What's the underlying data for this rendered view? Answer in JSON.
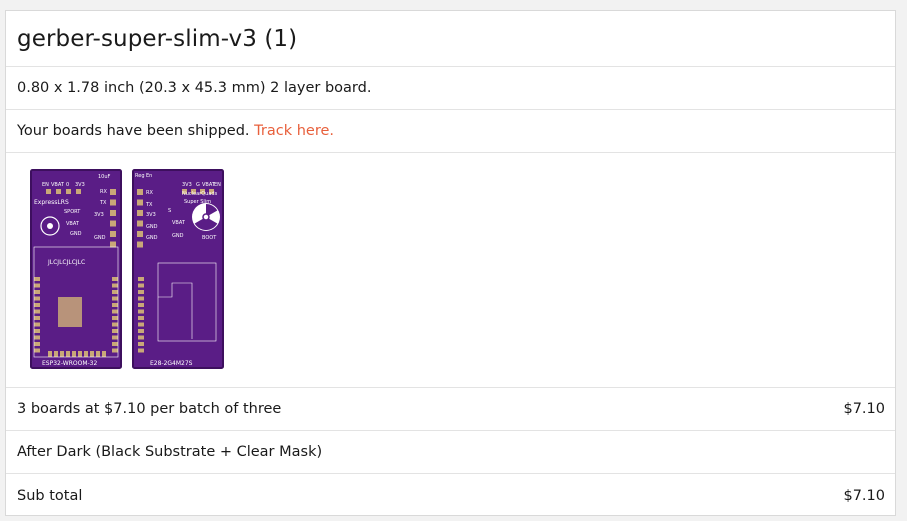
{
  "order": {
    "title": "gerber-super-slim-v3 (1)",
    "board_size": "0.80 x 1.78 inch (20.3 x 45.3 mm) 2 layer board.",
    "shipped_text": "Your boards have been shipped. ",
    "track_link": "Track here.",
    "line_item": {
      "label": "3 boards at $7.10 per batch of three",
      "price": "$7.10"
    },
    "option": {
      "label": "After Dark (Black Substrate + Clear Mask)"
    },
    "subtotal": {
      "label": "Sub total",
      "price": "$7.10"
    }
  },
  "board_images": {
    "top": {
      "silk": [
        "EN",
        "VBAT",
        "0",
        "3V3",
        "10uF",
        "RX",
        "TX",
        "ExpressLRS",
        "SPORT",
        "3V3",
        "VBAT",
        "GND",
        "GND",
        "JLCJLCJLCJLC",
        "ESP32-WROOM-32"
      ]
    },
    "bottom": {
      "silk": [
        "Reg",
        "En",
        "3V3",
        "G",
        "VBAT",
        "EN",
        "RX",
        "NuclearQuads",
        "TX",
        "Super Slim",
        "3V3",
        "S",
        "GND",
        "VBAT",
        "GND",
        "GND",
        "BOOT",
        "E28-2G4M27S"
      ]
    }
  },
  "colors": {
    "accent": "#e8603c",
    "pcb_purple": "#5a1d86",
    "pcb_edge": "#3d0f5e",
    "pad_gold": "#c9a878",
    "silk": "#ffffff"
  }
}
